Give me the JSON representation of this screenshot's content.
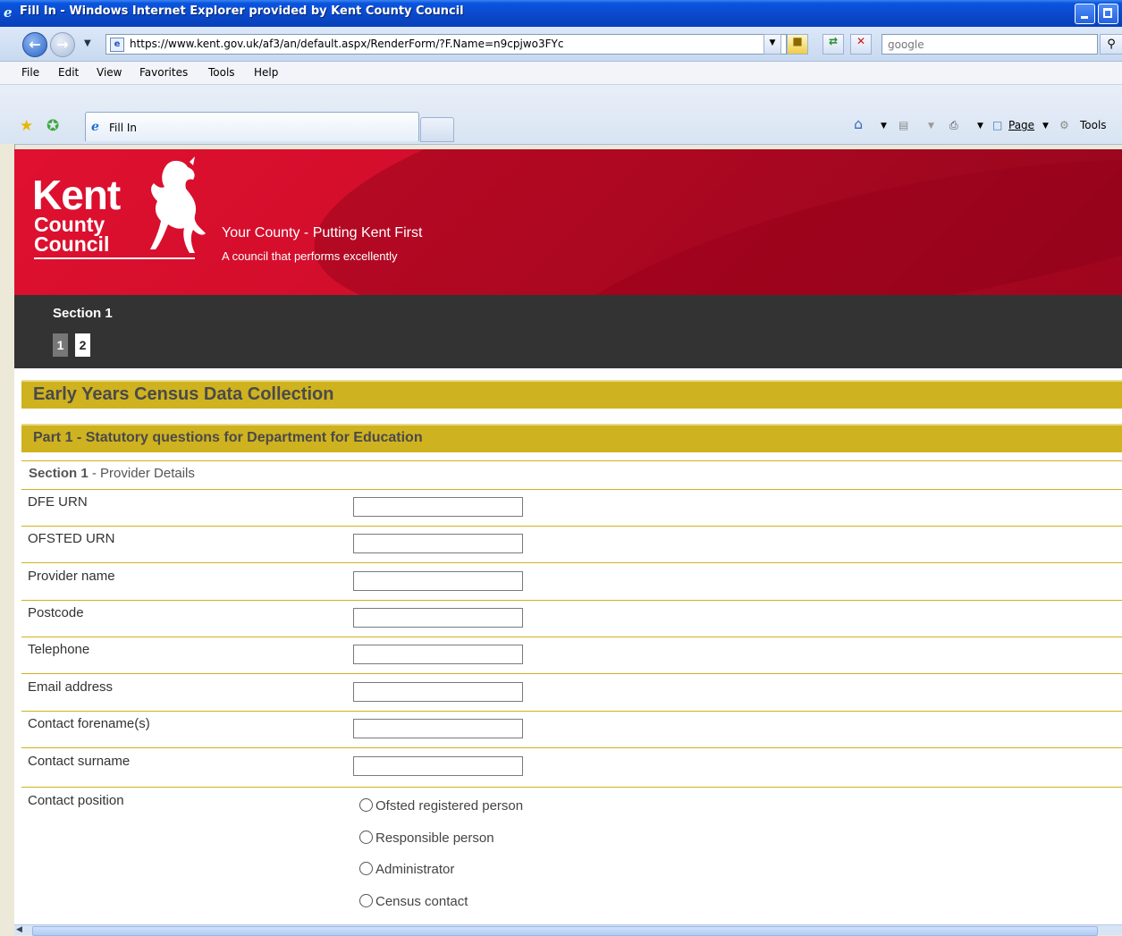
{
  "window": {
    "title": "Fill In - Windows Internet Explorer provided by Kent County Council"
  },
  "nav": {
    "url": "https://www.kent.gov.uk/af3/an/default.aspx/RenderForm/?F.Name=n9cpjwo3FYc",
    "search_value": "google"
  },
  "menu": {
    "file": "File",
    "edit": "Edit",
    "view": "View",
    "favorites": "Favorites",
    "tools": "Tools",
    "help": "Help"
  },
  "tabs": {
    "active_label": "Fill In"
  },
  "commandbar": {
    "page": "Page",
    "tools": "Tools"
  },
  "banner": {
    "logo_line1": "Kent",
    "logo_line2": "County",
    "logo_line3": "Council",
    "tagline": "Your County - Putting Kent First",
    "subtagline": "A council that performs excellently"
  },
  "sectionbar": {
    "title": "Section 1",
    "pages": [
      "1",
      "2"
    ]
  },
  "form": {
    "title": "Early Years Census Data Collection",
    "part_title": "Part 1 - Statutory questions for Department for Education",
    "section_prefix": "Section 1",
    "section_suffix": " - Provider Details",
    "fields": [
      {
        "label": "DFE URN",
        "value": ""
      },
      {
        "label": "OFSTED URN",
        "value": ""
      },
      {
        "label": "Provider name",
        "value": ""
      },
      {
        "label": "Postcode",
        "value": ""
      },
      {
        "label": "Telephone",
        "value": ""
      },
      {
        "label": "Email address",
        "value": ""
      },
      {
        "label": "Contact forename(s)",
        "value": ""
      },
      {
        "label": "Contact surname",
        "value": ""
      }
    ],
    "contact_position": {
      "label": "Contact position",
      "options": [
        "Ofsted registered person",
        "Responsible person",
        "Administrator",
        "Census contact"
      ]
    }
  },
  "colors": {
    "banner_red": "#d40e2c",
    "gold": "#cfb21f",
    "dark_bar": "#333333"
  }
}
